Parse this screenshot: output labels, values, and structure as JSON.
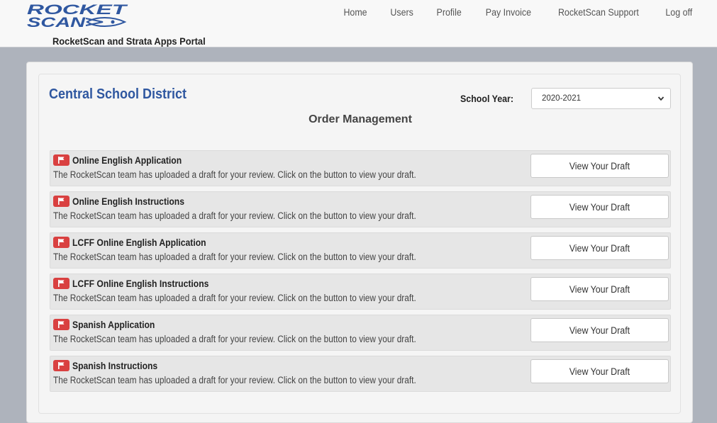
{
  "brand": {
    "logo_text": "ROCKET SCAN",
    "subtitle": "RocketScan and Strata Apps Portal"
  },
  "nav": {
    "items": [
      {
        "label": "Home"
      },
      {
        "label": "Users"
      },
      {
        "label": "Profile"
      },
      {
        "label": "Pay Invoice"
      },
      {
        "label": "RocketScan Support"
      },
      {
        "label": "Log off"
      }
    ]
  },
  "main": {
    "district": "Central School District",
    "school_year_label": "School Year:",
    "school_year_value": "2020-2021",
    "heading": "Order Management",
    "rows": [
      {
        "title": "Online English Application",
        "description": "The RocketScan team has uploaded a draft for your review. Click on the button to view your draft.",
        "button": "View Your Draft"
      },
      {
        "title": "Online English Instructions",
        "description": "The RocketScan team has uploaded a draft for your review. Click on the button to view your draft.",
        "button": "View Your Draft"
      },
      {
        "title": "LCFF Online English Application",
        "description": "The RocketScan team has uploaded a draft for your review. Click on the button to view your draft.",
        "button": "View Your Draft"
      },
      {
        "title": "LCFF Online English Instructions",
        "description": "The RocketScan team has uploaded a draft for your review. Click on the button to view your draft.",
        "button": "View Your Draft"
      },
      {
        "title": "Spanish Application",
        "description": "The RocketScan team has uploaded a draft for your review. Click on the button to view your draft.",
        "button": "View Your Draft"
      },
      {
        "title": "Spanish Instructions",
        "description": "The RocketScan team has uploaded a draft for your review. Click on the button to view your draft.",
        "button": "View Your Draft"
      }
    ]
  },
  "colors": {
    "brand_blue": "#2f57a0",
    "flag_red": "#d94040",
    "page_bg": "#aeb3bc"
  },
  "icons": {
    "flag": "flag-icon",
    "caret": "chevron-down-icon"
  }
}
